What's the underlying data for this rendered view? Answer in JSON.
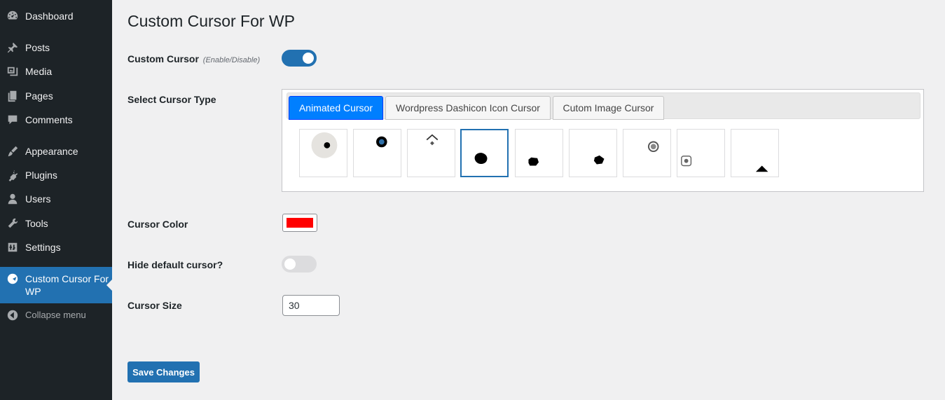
{
  "sidebar": {
    "items": [
      {
        "label": "Dashboard",
        "icon": "dashboard-icon"
      },
      {
        "label": "Posts",
        "icon": "pin-icon"
      },
      {
        "label": "Media",
        "icon": "media-icon"
      },
      {
        "label": "Pages",
        "icon": "pages-icon"
      },
      {
        "label": "Comments",
        "icon": "comment-icon"
      },
      {
        "label": "Appearance",
        "icon": "brush-icon"
      },
      {
        "label": "Plugins",
        "icon": "plugin-icon"
      },
      {
        "label": "Users",
        "icon": "users-icon"
      },
      {
        "label": "Tools",
        "icon": "wrench-icon"
      },
      {
        "label": "Settings",
        "icon": "settings-icon"
      },
      {
        "label": "Custom Cursor For WP",
        "icon": "cursor-plugin-icon",
        "active": true
      },
      {
        "label": "Collapse menu",
        "icon": "collapse-icon"
      }
    ]
  },
  "page": {
    "title": "Custom Cursor For WP",
    "custom_cursor_label": "Custom Cursor",
    "custom_cursor_hint": "(Enable/Disable)",
    "custom_cursor_enabled": true,
    "select_type_label": "Select Cursor Type",
    "tabs": [
      "Animated Cursor",
      "Wordpress Dashicon Icon Cursor",
      "Cutom Image Cursor"
    ],
    "active_tab": 0,
    "selected_cursor_index": 3,
    "cursor_color_label": "Cursor Color",
    "cursor_color": "#ff0000",
    "hide_default_label": "Hide default cursor?",
    "hide_default_enabled": false,
    "cursor_size_label": "Cursor Size",
    "cursor_size_value": "30",
    "save_label": "Save Changes"
  },
  "colors": {
    "sidebar_bg": "#1d2327",
    "accent": "#2271b1",
    "tab_active": "#007fff"
  }
}
